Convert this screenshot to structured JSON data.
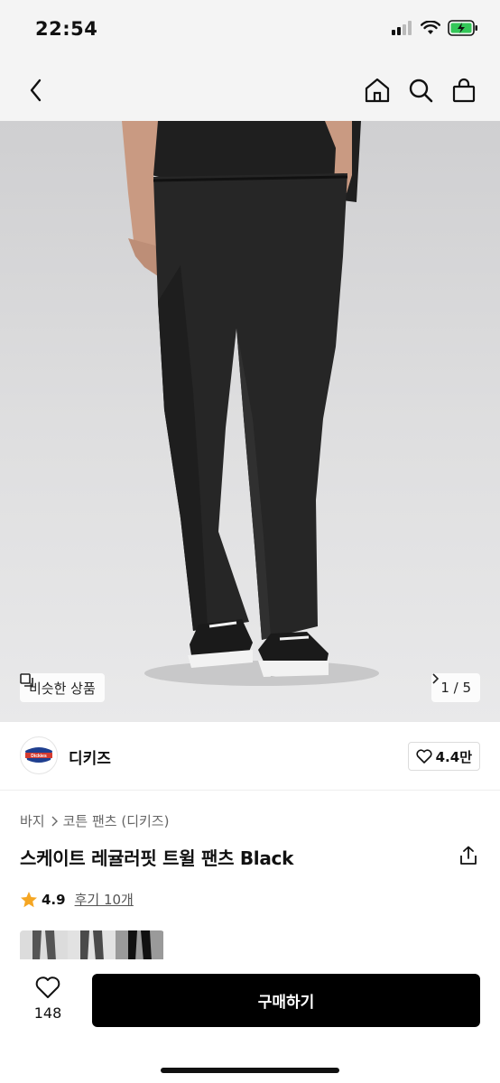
{
  "status_bar": {
    "time": "22:54",
    "icons": [
      "signal-icon",
      "wifi-icon",
      "battery-charging-icon"
    ]
  },
  "nav": {
    "back_icon": "chevron-left-icon",
    "right_icons": [
      "home-icon",
      "search-icon",
      "shopping-bag-icon"
    ]
  },
  "hero": {
    "similar_label": "비슷한 상품",
    "page_indicator": "1 / 5",
    "colors": {
      "background": "#d9d9da",
      "pants": "#262626",
      "shoes": "#1a1a1a"
    }
  },
  "brand": {
    "name": "디키즈",
    "logo_text": "Dickies",
    "likes": "4.4만"
  },
  "breadcrumb": [
    "바지",
    "코튼 팬츠 (디키즈)"
  ],
  "product": {
    "title": "스케이트 레귤러핏 트윌 팬츠 Black"
  },
  "rating": {
    "score": "4.9",
    "review_link": "후기 10개",
    "star_color": "#f5a623"
  },
  "bottom": {
    "like_count": "148",
    "buy_label": "구매하기"
  }
}
